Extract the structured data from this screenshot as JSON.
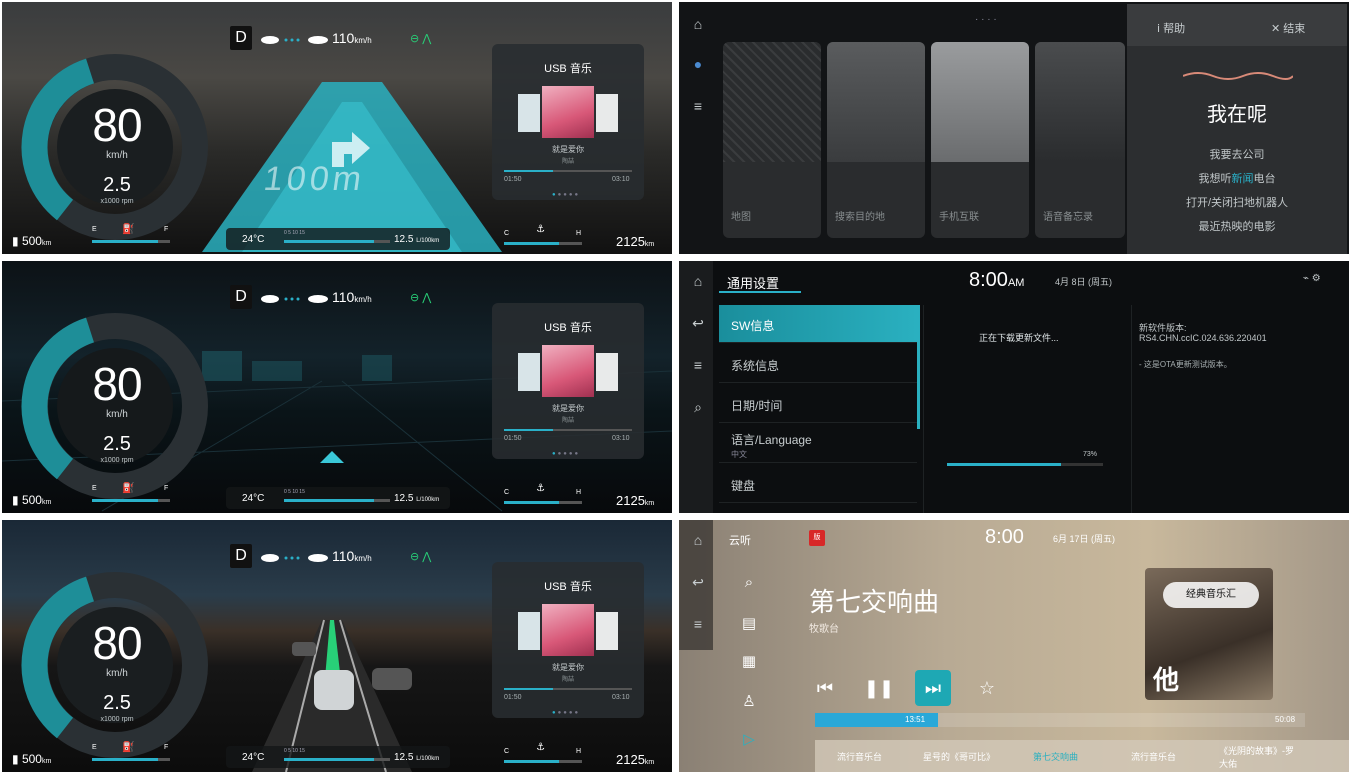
{
  "colors": {
    "accent": "#2ab0c8",
    "green": "#28d078",
    "cluster_gauge": "#1e8e98"
  },
  "cluster": {
    "gear": "D",
    "set_speed": "110",
    "set_speed_unit": "km/h",
    "speed": "80",
    "speed_unit": "km/h",
    "rpm": "2.5",
    "rpm_unit": "x1000 rpm",
    "range": "500",
    "range_unit": "km",
    "fuel_e": "E",
    "fuel_f": "F",
    "fuel_level": 0.85,
    "temp": "24",
    "temp_unit": "°C",
    "econ_scale": "0   5   10   15",
    "econ_level": 0.85,
    "econ": "12.5",
    "econ_unit": "L/100km",
    "coolant_c": "C",
    "coolant_h": "H",
    "coolant_level": 0.7,
    "odometer": "2125",
    "odometer_unit": "km",
    "nav_distance": "100m",
    "media": {
      "title": "USB 音乐",
      "song": "就是爱你",
      "artist": "陶喆",
      "time_current": "01:50",
      "time_total": "03:10",
      "progress": 0.38
    }
  },
  "voice": {
    "cards": [
      "地图",
      "搜索目的地",
      "手机互联",
      "语音备忘录"
    ],
    "help": "帮助",
    "end": "结束",
    "title": "我在呢",
    "suggestions": [
      {
        "pre": "我要去公司",
        "hl": "",
        "post": ""
      },
      {
        "pre": "我想听",
        "hl": "新闻",
        "post": "电台"
      },
      {
        "pre": "打开/关闭扫地机器人",
        "hl": "",
        "post": ""
      },
      {
        "pre": "最近热映的电影",
        "hl": "",
        "post": ""
      }
    ]
  },
  "settings": {
    "title": "通用设置",
    "time": "8:00",
    "ampm": "AM",
    "date": "4月 8日 (周五)",
    "menu": [
      {
        "label": "SW信息",
        "sub": "",
        "active": true
      },
      {
        "label": "系统信息",
        "sub": "",
        "active": false
      },
      {
        "label": "日期/时间",
        "sub": "",
        "active": false
      },
      {
        "label": "语言/Language",
        "sub": "中文",
        "active": false
      },
      {
        "label": "键盘",
        "sub": "",
        "active": false
      }
    ],
    "download_status": "正在下载更新文件...",
    "download_percent": "73%",
    "download_progress": 0.73,
    "version_label": "新软件版本:",
    "version_value": "RS4.CHN.ccIC.024.636.220401",
    "version_note": "- 这是OTA更新测试版本。"
  },
  "music": {
    "app": "云听",
    "time": "8:00",
    "date": "6月 17日 (周五)",
    "title": "第七交响曲",
    "subtitle": "牧歌台",
    "album_logo": "经典音乐汇",
    "album_char": "他",
    "time_current": "13:51",
    "time_total": "50:08",
    "progress": 0.25,
    "playlist": [
      "流行音乐台",
      "星号的《哥可比》",
      "第七交响曲",
      "流行音乐台",
      "《光阴的故事》-罗大佑"
    ],
    "active_index": 2
  }
}
